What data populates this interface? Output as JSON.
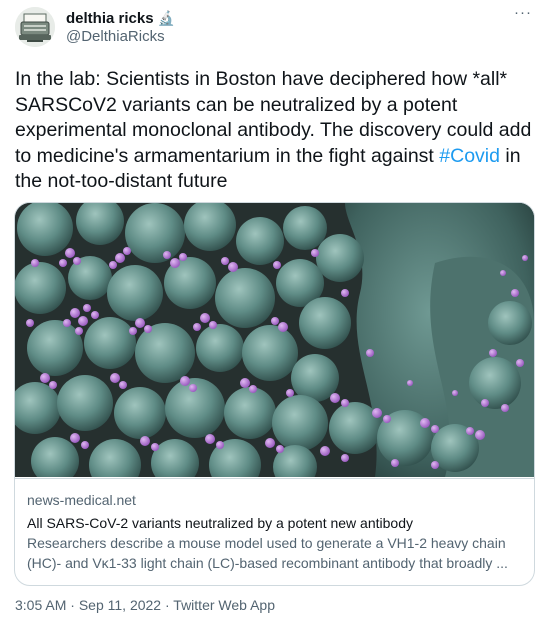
{
  "author": {
    "display_name": "delthia ricks",
    "name_emoji": "🔬",
    "handle": "@DelthiaRicks",
    "avatar_icon": "typewriter-icon"
  },
  "more_label": "···",
  "tweet": {
    "text_before": "In the lab: Scientists in Boston have deciphered how *all* SARSCoV2 variants can be neutralized by a potent experimental monoclonal antibody. The discovery could add to medicine's armamentarium in the fight against ",
    "hashtag": "#Covid",
    "text_after": " in the not-too-distant future"
  },
  "card": {
    "domain": "news-medical.net",
    "title": "All SARS-CoV-2 variants neutralized by a potent new antibody",
    "description_line1": "Researchers describe a mouse model used to generate a VH1-2 heavy chain",
    "description_line2": "(HC)- and Vκ1-33 light chain (LC)-based recombinant antibody that broadly ..."
  },
  "meta": {
    "time": "3:05 AM",
    "date": "Sep 11, 2022",
    "separator": "·",
    "source": "Twitter Web App"
  },
  "colors": {
    "link": "#1d9bf0",
    "secondary_text": "#536471",
    "primary_text": "#0f1419",
    "border": "#cfd9de",
    "cell_teal": "#5f8c86",
    "virus_purple": "#b07ad0"
  }
}
